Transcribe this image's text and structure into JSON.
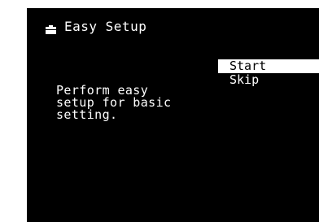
{
  "title": {
    "icon": "toolbox-icon",
    "label": "Easy Setup"
  },
  "menu": {
    "items": [
      {
        "label": "Start",
        "selected": true
      },
      {
        "label": "Skip",
        "selected": false
      }
    ]
  },
  "description": {
    "lines": [
      "Perform easy",
      "setup for basic",
      "setting."
    ]
  },
  "colors": {
    "background": "#000000",
    "text": "#ffffff",
    "highlight": "#ffffff",
    "highlight_text": "#000000"
  }
}
